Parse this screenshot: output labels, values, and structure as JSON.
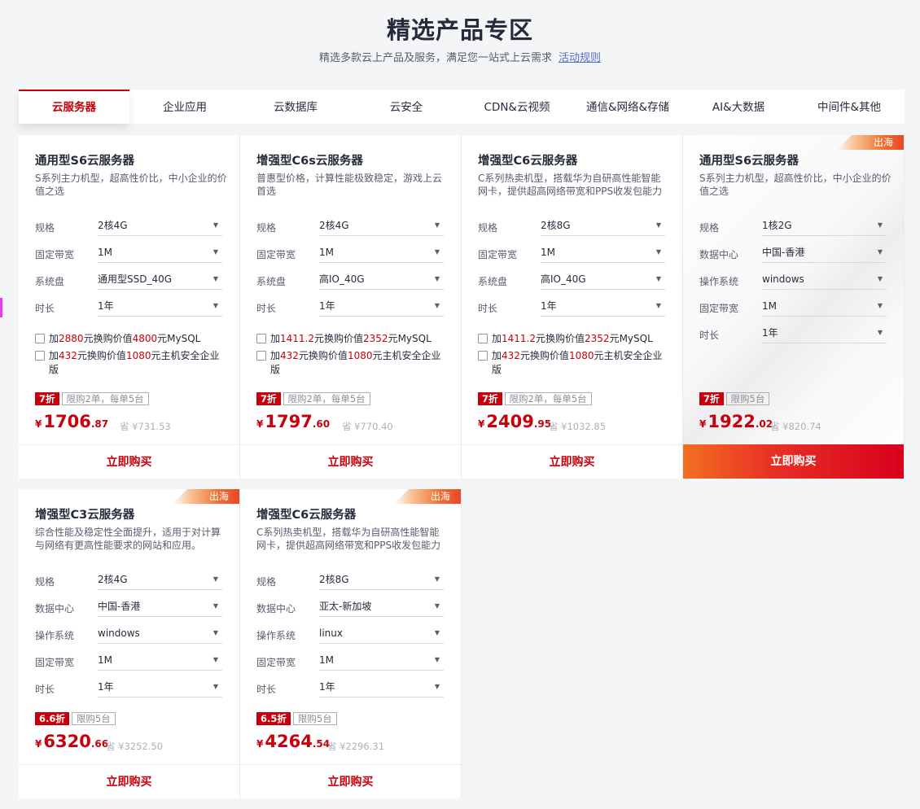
{
  "page": {
    "title": "精选产品专区",
    "subtitle": "精选多款云上产品及服务，满足您一站式上云需求",
    "rules_link": "活动规则"
  },
  "tabs": [
    {
      "label": "云服务器",
      "active": true
    },
    {
      "label": "企业应用"
    },
    {
      "label": "云数据库"
    },
    {
      "label": "云安全"
    },
    {
      "label": "CDN&云视频"
    },
    {
      "label": "通信&网络&存储"
    },
    {
      "label": "AI&大数据"
    },
    {
      "label": "中间件&其他"
    }
  ],
  "buy_label": "立即购买",
  "ribbon_label": "出海",
  "colors": {
    "accent": "#c7000b",
    "subtitle_link": "#526ecc"
  },
  "cards": [
    {
      "title": "通用型S6云服务器",
      "desc": "S系列主力机型，超高性价比，中小企业的价值之选",
      "specs": [
        {
          "label": "规格",
          "value": "2核4G"
        },
        {
          "label": "固定带宽",
          "value": "1M"
        },
        {
          "label": "系统盘",
          "value": "通用型SSD_40G"
        },
        {
          "label": "时长",
          "value": "1年"
        }
      ],
      "addons": [
        {
          "p1": "加",
          "r1": "2880",
          "p2": "元换购价值",
          "r2": "4800",
          "p3": "元MySQL"
        },
        {
          "p1": "加",
          "r1": "432",
          "p2": "元换购价值",
          "r2": "1080",
          "p3": "元主机安全企业版"
        }
      ],
      "discount": "7折",
      "limit": "限购2单，每单5台",
      "currency": "¥",
      "price_int": "1706",
      "price_dec": ".87",
      "save": "省 ¥731.53"
    },
    {
      "title": "增强型C6s云服务器",
      "desc": "普惠型价格，计算性能极致稳定，游戏上云首选",
      "specs": [
        {
          "label": "规格",
          "value": "2核4G"
        },
        {
          "label": "固定带宽",
          "value": "1M"
        },
        {
          "label": "系统盘",
          "value": "高IO_40G"
        },
        {
          "label": "时长",
          "value": "1年"
        }
      ],
      "addons": [
        {
          "p1": "加",
          "r1": "1411.2",
          "p2": "元换购价值",
          "r2": "2352",
          "p3": "元MySQL"
        },
        {
          "p1": "加",
          "r1": "432",
          "p2": "元换购价值",
          "r2": "1080",
          "p3": "元主机安全企业版"
        }
      ],
      "discount": "7折",
      "limit": "限购2单，每单5台",
      "currency": "¥",
      "price_int": "1797",
      "price_dec": ".60",
      "save": "省 ¥770.40"
    },
    {
      "title": "增强型C6云服务器",
      "desc": "C系列热卖机型，搭载华为自研高性能智能网卡，提供超高网络带宽和PPS收发包能力",
      "specs": [
        {
          "label": "规格",
          "value": "2核8G"
        },
        {
          "label": "固定带宽",
          "value": "1M"
        },
        {
          "label": "系统盘",
          "value": "高IO_40G"
        },
        {
          "label": "时长",
          "value": "1年"
        }
      ],
      "addons": [
        {
          "p1": "加",
          "r1": "1411.2",
          "p2": "元换购价值",
          "r2": "2352",
          "p3": "元MySQL"
        },
        {
          "p1": "加",
          "r1": "432",
          "p2": "元换购价值",
          "r2": "1080",
          "p3": "元主机安全企业版"
        }
      ],
      "discount": "7折",
      "limit": "限购2单，每单5台",
      "currency": "¥",
      "price_int": "2409",
      "price_dec": ".95",
      "save": "省 ¥1032.85"
    },
    {
      "title": "通用型S6云服务器",
      "desc": "S系列主力机型，超高性价比，中小企业的价值之选",
      "specs": [
        {
          "label": "规格",
          "value": "1核2G"
        },
        {
          "label": "数据中心",
          "value": "中国-香港"
        },
        {
          "label": "操作系统",
          "value": "windows"
        },
        {
          "label": "固定带宽",
          "value": "1M"
        },
        {
          "label": "时长",
          "value": "1年"
        }
      ],
      "discount": "7折",
      "limit": "限购5台",
      "currency": "¥",
      "price_int": "1922",
      "price_dec": ".02",
      "save": "省 ¥820.74"
    },
    {
      "title": "增强型C3云服务器",
      "desc": "综合性能及稳定性全面提升，适用于对计算与网络有更高性能要求的网站和应用。",
      "specs": [
        {
          "label": "规格",
          "value": "2核4G"
        },
        {
          "label": "数据中心",
          "value": "中国-香港"
        },
        {
          "label": "操作系统",
          "value": "windows"
        },
        {
          "label": "固定带宽",
          "value": "1M"
        },
        {
          "label": "时长",
          "value": "1年"
        }
      ],
      "discount": "6.6折",
      "limit": "限购5台",
      "currency": "¥",
      "price_int": "6320",
      "price_dec": ".66",
      "save": "省 ¥3252.50"
    },
    {
      "title": "增强型C6云服务器",
      "desc": "C系列热卖机型，搭载华为自研高性能智能网卡，提供超高网络带宽和PPS收发包能力",
      "specs": [
        {
          "label": "规格",
          "value": "2核8G"
        },
        {
          "label": "数据中心",
          "value": "亚太-新加坡"
        },
        {
          "label": "操作系统",
          "value": "linux"
        },
        {
          "label": "固定带宽",
          "value": "1M"
        },
        {
          "label": "时长",
          "value": "1年"
        }
      ],
      "discount": "6.5折",
      "limit": "限购5台",
      "currency": "¥",
      "price_int": "4264",
      "price_dec": ".54",
      "save": "省 ¥2296.31"
    }
  ]
}
